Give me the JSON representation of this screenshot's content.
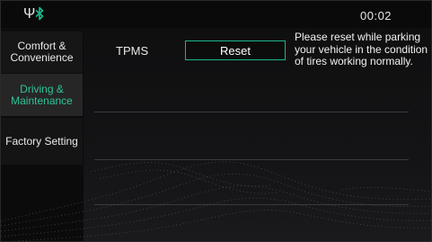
{
  "status_bar": {
    "usb_icon": "usb-icon",
    "bluetooth_icon": "bluetooth-icon",
    "bluetooth_color": "#1fb88e",
    "clock": "00:02"
  },
  "sidebar": {
    "items": [
      {
        "label": "Comfort &\nConvenience",
        "selected": false
      },
      {
        "label": "Driving &\nMaintenance",
        "selected": true
      },
      {
        "label": "Factory Setting",
        "selected": false
      }
    ],
    "selected_color": "#30c39a"
  },
  "main": {
    "tpms_label": "TPMS",
    "reset_label": "Reset",
    "reset_note": "Please reset while parking your vehicle in the condition of tires working normally."
  },
  "colors": {
    "accent": "#1eb48c",
    "background": "#0b0b0c"
  }
}
